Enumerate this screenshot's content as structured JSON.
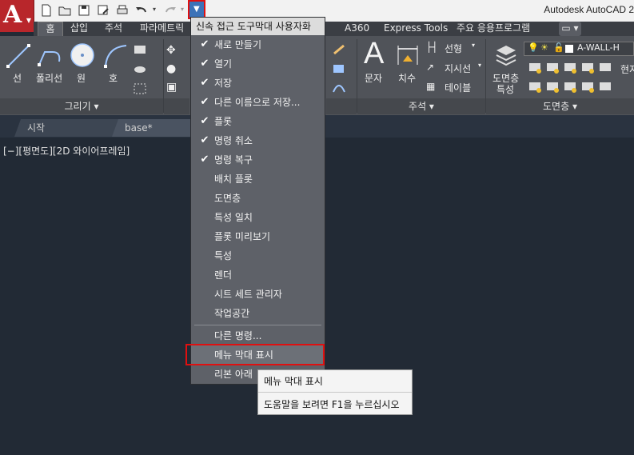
{
  "app": {
    "title": "Autodesk AutoCAD 2",
    "logo_letter": "A"
  },
  "ribbon_tabs": [
    "홈",
    "삽입",
    "주석",
    "파라메트릭",
    "A360",
    "Express Tools",
    "주요 응용프로그램"
  ],
  "ribbon": {
    "draw": {
      "line": "선",
      "polyline": "폴리선",
      "circle": "원",
      "arc": "호",
      "panel": "그리기 ▾"
    },
    "annotation": {
      "text": "문자",
      "dimension": "치수",
      "linear": "선형",
      "leader": "지시선",
      "table": "테이블",
      "panel": "주석 ▾"
    },
    "layers": {
      "properties_line1": "도면층",
      "properties_line2": "특성",
      "current_layer": "A-WALL-H",
      "current_label": "현지",
      "panel": "도면층 ▾"
    }
  },
  "file_tabs": [
    "시작",
    "base*"
  ],
  "viewport": {
    "label": "[−][평면도][2D 와이어프레임]"
  },
  "menu": {
    "header": "신속 접근 도구막대 사용자화",
    "checked_items": [
      "새로 만들기",
      "열기",
      "저장",
      "다른 이름으로 저장...",
      "플롯",
      "명령 취소",
      "명령 복구"
    ],
    "items": [
      "배치 플롯",
      "도면층",
      "특성 일치",
      "플롯 미리보기",
      "특성",
      "렌더",
      "시트 세트 관리자",
      "작업공간"
    ],
    "more_commands": "다른 명령...",
    "show_menu_bar": "메뉴 막대 표시",
    "ribbon_below": "리본 아래"
  },
  "tooltip": {
    "title": "메뉴 막대 표시",
    "help": "도움말을 보려면 F1을 누르십시오"
  },
  "colors": {
    "highlight_border": "#e01010",
    "app_button": "#b8262b",
    "drawing_bg": "#222a35"
  }
}
